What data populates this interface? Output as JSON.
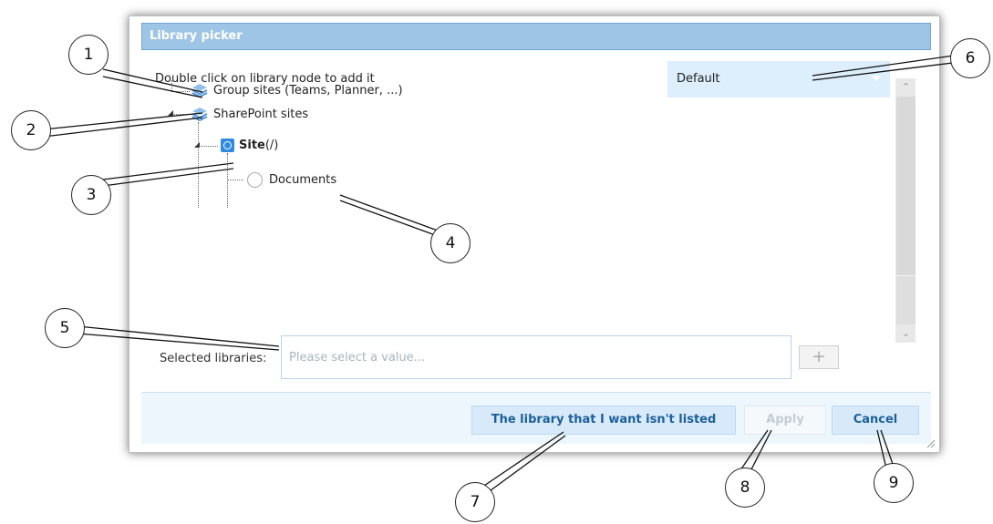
{
  "dialog": {
    "title": "Library picker",
    "instruction": "Double click on library node to add it",
    "view_select": {
      "value": "Default"
    },
    "tree": {
      "group_sites": "Group sites (Teams, Planner, ...)",
      "sharepoint_sites": "SharePoint sites",
      "site_name": "Site",
      "site_path": "(/)",
      "documents": "Documents"
    },
    "selected": {
      "label": "Selected libraries:",
      "placeholder": "Please select a value..."
    },
    "plus_label": "+",
    "buttons": {
      "not_listed": "The library that I want isn't listed",
      "apply": "Apply",
      "cancel": "Cancel"
    }
  },
  "callouts": [
    "1",
    "2",
    "3",
    "4",
    "5",
    "6",
    "7",
    "8",
    "9"
  ],
  "colors": {
    "title_bar": "#9ec5e6",
    "select_bg": "#ddeefc",
    "button_text": "#1d5f9b",
    "site_icon": "#2f8ae0"
  }
}
